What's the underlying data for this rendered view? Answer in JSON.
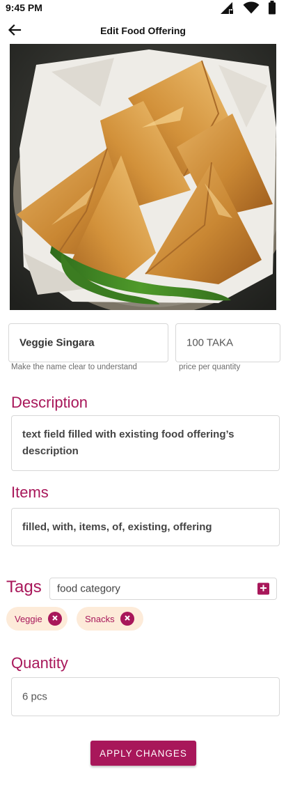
{
  "status_bar": {
    "time": "9:45 PM"
  },
  "app_bar": {
    "title": "Edit Food Offering"
  },
  "name_field": {
    "value": "Veggie Singara",
    "helper": "Make the name clear to understand"
  },
  "price_field": {
    "value": "100 TAKA",
    "helper": "price per quantity"
  },
  "description": {
    "label": "Description",
    "value": "text field filled with existing food offering’s description"
  },
  "items": {
    "label": "Items",
    "value": "filled, with, items, of, existing, offering"
  },
  "tags": {
    "label": "Tags",
    "input_value": "food category",
    "chips": [
      {
        "label": "Veggie"
      },
      {
        "label": "Snacks"
      }
    ]
  },
  "quantity": {
    "label": "Quantity",
    "value": "6 pcs"
  },
  "apply_button": {
    "label": "APPLY CHANGES"
  },
  "colors": {
    "accent": "#a8175a",
    "chip_bg": "#fdebd9",
    "border": "#d7d7d7"
  }
}
